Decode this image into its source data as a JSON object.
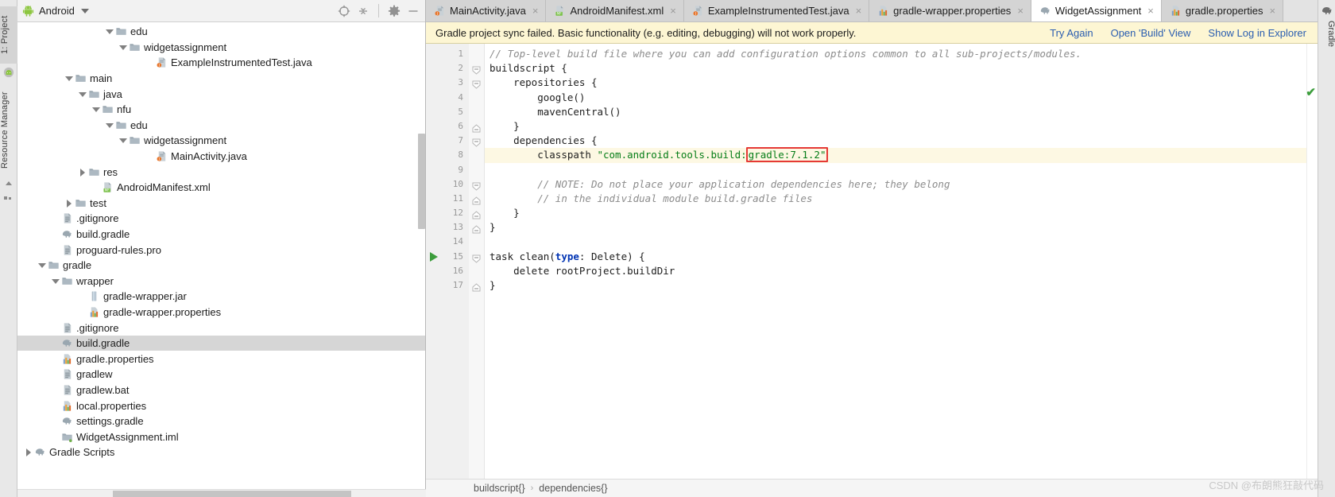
{
  "left_strip": {
    "project_tab": "1: Project",
    "resource_tab": "Resource Manager"
  },
  "right_strip": {
    "gradle_tab": "Gradle"
  },
  "project_panel": {
    "title": "Android",
    "icons": [
      "android-icon",
      "chevron-down-icon",
      "locate-icon",
      "collapse-all-icon",
      "gear-icon",
      "hide-icon"
    ],
    "tree": [
      {
        "label": "edu",
        "indent": 6,
        "twisty": "open",
        "icon": "folder",
        "selected": false
      },
      {
        "label": "widgetassignment",
        "indent": 7,
        "twisty": "open",
        "icon": "folder",
        "selected": false
      },
      {
        "label": "ExampleInstrumentedTest.java",
        "indent": 9,
        "twisty": "none",
        "icon": "java",
        "selected": false
      },
      {
        "label": "main",
        "indent": 3,
        "twisty": "open",
        "icon": "folder",
        "selected": false
      },
      {
        "label": "java",
        "indent": 4,
        "twisty": "open",
        "icon": "folder",
        "selected": false
      },
      {
        "label": "nfu",
        "indent": 5,
        "twisty": "open",
        "icon": "folder",
        "selected": false
      },
      {
        "label": "edu",
        "indent": 6,
        "twisty": "open",
        "icon": "folder",
        "selected": false
      },
      {
        "label": "widgetassignment",
        "indent": 7,
        "twisty": "open",
        "icon": "folder",
        "selected": false
      },
      {
        "label": "MainActivity.java",
        "indent": 9,
        "twisty": "none",
        "icon": "java",
        "selected": false
      },
      {
        "label": "res",
        "indent": 4,
        "twisty": "closed",
        "icon": "folder",
        "selected": false
      },
      {
        "label": "AndroidManifest.xml",
        "indent": 5,
        "twisty": "none",
        "icon": "manifest",
        "selected": false
      },
      {
        "label": "test",
        "indent": 3,
        "twisty": "closed",
        "icon": "folder",
        "selected": false
      },
      {
        "label": ".gitignore",
        "indent": 2,
        "twisty": "none",
        "icon": "file",
        "selected": false
      },
      {
        "label": "build.gradle",
        "indent": 2,
        "twisty": "none",
        "icon": "gradle",
        "selected": false
      },
      {
        "label": "proguard-rules.pro",
        "indent": 2,
        "twisty": "none",
        "icon": "file",
        "selected": false
      },
      {
        "label": "gradle",
        "indent": 1,
        "twisty": "open",
        "icon": "folder",
        "selected": false
      },
      {
        "label": "wrapper",
        "indent": 2,
        "twisty": "open",
        "icon": "folder",
        "selected": false
      },
      {
        "label": "gradle-wrapper.jar",
        "indent": 4,
        "twisty": "none",
        "icon": "jar",
        "selected": false
      },
      {
        "label": "gradle-wrapper.properties",
        "indent": 4,
        "twisty": "none",
        "icon": "props",
        "selected": false
      },
      {
        "label": ".gitignore",
        "indent": 2,
        "twisty": "none",
        "icon": "file",
        "selected": false
      },
      {
        "label": "build.gradle",
        "indent": 2,
        "twisty": "none",
        "icon": "gradle",
        "selected": true
      },
      {
        "label": "gradle.properties",
        "indent": 2,
        "twisty": "none",
        "icon": "props",
        "selected": false
      },
      {
        "label": "gradlew",
        "indent": 2,
        "twisty": "none",
        "icon": "file",
        "selected": false
      },
      {
        "label": "gradlew.bat",
        "indent": 2,
        "twisty": "none",
        "icon": "file",
        "selected": false
      },
      {
        "label": "local.properties",
        "indent": 2,
        "twisty": "none",
        "icon": "props",
        "selected": false
      },
      {
        "label": "settings.gradle",
        "indent": 2,
        "twisty": "none",
        "icon": "gradle",
        "selected": false
      },
      {
        "label": "WidgetAssignment.iml",
        "indent": 2,
        "twisty": "none",
        "icon": "iml",
        "selected": false
      },
      {
        "label": "Gradle Scripts",
        "indent": 0,
        "twisty": "closed",
        "icon": "gradle",
        "selected": false
      }
    ]
  },
  "editor": {
    "tabs": [
      {
        "label": "MainActivity.java",
        "icon": "java",
        "active": false,
        "closable": true
      },
      {
        "label": "AndroidManifest.xml",
        "icon": "manifest",
        "active": false,
        "closable": true
      },
      {
        "label": "ExampleInstrumentedTest.java",
        "icon": "java",
        "active": false,
        "closable": true
      },
      {
        "label": "gradle-wrapper.properties",
        "icon": "props",
        "active": false,
        "closable": true
      },
      {
        "label": "WidgetAssignment",
        "icon": "gradle",
        "active": true,
        "closable": true
      },
      {
        "label": "gradle.properties",
        "icon": "props",
        "active": false,
        "closable": true
      }
    ],
    "notification": {
      "message": "Gradle project sync failed. Basic functionality (e.g. editing, debugging) will not work properly.",
      "links": [
        "Try Again",
        "Open 'Build' View",
        "Show Log in Explorer"
      ],
      "background": "#fdf6d3"
    },
    "line_numbers": [
      "1",
      "2",
      "3",
      "4",
      "5",
      "6",
      "7",
      "8",
      "9",
      "10",
      "11",
      "12",
      "13",
      "14",
      "15",
      "16",
      "17"
    ],
    "lines": [
      {
        "n": 1,
        "text": "    // Top-level build file where you can add configuration options common to all sub-projects/modules."
      },
      {
        "n": 2,
        "text": "buildscript {"
      },
      {
        "n": 3,
        "text": "    repositories {"
      },
      {
        "n": 4,
        "text": "        google()"
      },
      {
        "n": 5,
        "text": "        mavenCentral()"
      },
      {
        "n": 6,
        "text": "    }"
      },
      {
        "n": 7,
        "text": "    dependencies {"
      },
      {
        "n": 8,
        "text": "        classpath \"com.android.tools.build:gradle:7.1.2\""
      },
      {
        "n": 9,
        "text": ""
      },
      {
        "n": 10,
        "text": "        // NOTE: Do not place your application dependencies here; they belong"
      },
      {
        "n": 11,
        "text": "        // in the individual module build.gradle files"
      },
      {
        "n": 12,
        "text": "    }"
      },
      {
        "n": 13,
        "text": "}"
      },
      {
        "n": 14,
        "text": ""
      },
      {
        "n": 15,
        "text": "task clean(type: Delete) {"
      },
      {
        "n": 16,
        "text": "    delete rootProject.buildDir"
      },
      {
        "n": 17,
        "text": "}"
      }
    ],
    "code_fragments": {
      "l1_comment": "// Top-level build file where you can add configuration options common to all sub-projects/modules.",
      "l2": "buildscript {",
      "l3": "repositories {",
      "l4": "google()",
      "l5": "mavenCentral()",
      "l6": "}",
      "l7": "dependencies {",
      "l8_keyword": "classpath ",
      "l8_str_prefix": "\"com.android.tools.build:",
      "l8_str_highlight": "gradle:7.1.2\"",
      "l10_comment": "// NOTE: Do not place your application dependencies here; they belong",
      "l11_comment": "// in the individual module build.gradle files",
      "l12": "}",
      "l13": "}",
      "l15_a": "task clean(",
      "l15_kw": "type",
      "l15_b": ": Delete) {",
      "l16": "delete rootProject.buildDir",
      "l17": "}"
    },
    "breadcrumbs": [
      "buildscript{}",
      "dependencies{}"
    ],
    "highlight_color": "#e53935",
    "highlight_line": 8,
    "run_gutter_line": 15,
    "status_check": "✔"
  },
  "watermark": "CSDN @布朗熊狂敲代码"
}
